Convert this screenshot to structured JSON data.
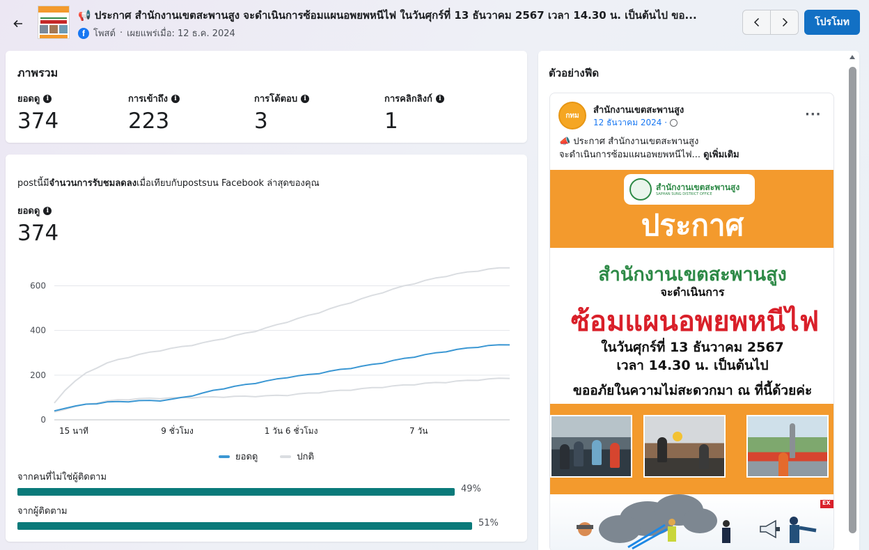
{
  "header": {
    "title": "📢 ประกาศ สำนักงานเขตสะพานสูง จะดำเนินการซ้อมแผนอพยพหนีไฟ ในวันศุกร์ที่ 13 ธันวาคม 2567 เวลา 14.30 น. เป็นต้นไป ขอ...",
    "post_type": "โพสต์",
    "published_text": "เผยแพร่เมื่อ: 12 ธ.ค. 2024",
    "promote_label": "โปรโมท",
    "icons": {
      "back": "arrow-left-icon",
      "prev": "chevron-left-icon",
      "next": "chevron-right-icon",
      "platform": "facebook-icon"
    }
  },
  "overview": {
    "title": "ภาพรวม",
    "metrics": [
      {
        "label": "ยอดดู",
        "value": "374"
      },
      {
        "label": "การเข้าถึง",
        "value": "223"
      },
      {
        "label": "การโต้ตอบ",
        "value": "3"
      },
      {
        "label": "การคลิกลิงก์",
        "value": "1"
      }
    ]
  },
  "performance": {
    "desc_prefix": "postนี้มี",
    "desc_bold": "จำนวนการรับชมลดลง",
    "desc_suffix": "เมื่อเทียบกับpostsบน Facebook ล่าสุดของคุณ",
    "metric_label": "ยอดดู",
    "metric_value": "374",
    "breakdown": [
      {
        "label": "จากคนที่ไม่ใช่ผู้ติดตาม",
        "percent_text": "49%",
        "fraction": 0.49
      },
      {
        "label": "จากผู้ติดตาม",
        "percent_text": "51%",
        "fraction": 0.51
      }
    ]
  },
  "chart_data": {
    "type": "line",
    "x_ticks": [
      "15 นาที",
      "9 ชั่วโมง",
      "1 วัน 6 ชั่วโมง",
      "7 วัน"
    ],
    "y_ticks": [
      0,
      200,
      400,
      600
    ],
    "ylim": [
      0,
      720
    ],
    "grid": true,
    "legend_position": "bottom",
    "series": [
      {
        "name": "ยอดดู",
        "color": "#3b97d3",
        "values": [
          40,
          55,
          62,
          70,
          75,
          80,
          82,
          84,
          86,
          87,
          88,
          92,
          100,
          110,
          120,
          132,
          142,
          150,
          158,
          166,
          174,
          183,
          192,
          197,
          203,
          210,
          218,
          226,
          233,
          240,
          248,
          257,
          266,
          275,
          284,
          292,
          300,
          308,
          315,
          322,
          328,
          333,
          336,
          339
        ]
      },
      {
        "name": "ปกติ",
        "color": "#dadde1",
        "values": [
          35,
          50,
          60,
          70,
          78,
          85,
          90,
          93,
          95,
          97,
          98,
          99,
          100,
          101,
          102,
          103,
          104,
          105,
          106,
          107,
          108,
          110,
          112,
          116,
          120,
          124,
          128,
          132,
          136,
          140,
          144,
          148,
          152,
          156,
          160,
          164,
          167,
          170,
          174,
          177,
          180,
          183,
          186,
          189
        ]
      },
      {
        "name": "",
        "color": "#dadde1",
        "values": [
          75,
          135,
          175,
          210,
          235,
          255,
          270,
          282,
          293,
          303,
          312,
          320,
          328,
          336,
          345,
          355,
          366,
          377,
          388,
          399,
          412,
          426,
          440,
          454,
          468,
          482,
          497,
          512,
          527,
          542,
          557,
          572,
          586,
          600,
          612,
          624,
          635,
          645,
          654,
          662,
          669,
          675,
          680,
          684
        ]
      }
    ]
  },
  "feed": {
    "title": "ตัวอย่างฟีด",
    "page_name": "สำนักงานเขตสะพานสูง",
    "avatar_text": "กทม",
    "post_date": "12 ธันวาคม 2024 ·",
    "more_label": "···",
    "text_line1": "📣 ประกาศ สำนักงานเขตสะพานสูง",
    "text_line2": "จะดำเนินการซ้อมแผนอพยพหนีไฟ...",
    "see_more": "ดูเพิ่มเติม",
    "poster": {
      "office_name": "สำนักงานเขตสะพานสูง",
      "office_sub": "SAPHAN SUNG DISTRICT OFFICE",
      "announce": "ประกาศ",
      "office_big": "สำนักงานเขตสะพานสูง",
      "will_do": "จะดำเนินการ",
      "drill": "ซ้อมแผนอพยพหนีไฟ",
      "date": "ในวันศุกร์ที่ 13 ธันวาคม 2567",
      "time": "เวลา 14.30 น. เป็นต้นไป",
      "apology": "ขออภัยในความไม่สะดวกมา ณ ที่นี้ด้วยค่ะ",
      "exit": "EX"
    }
  }
}
